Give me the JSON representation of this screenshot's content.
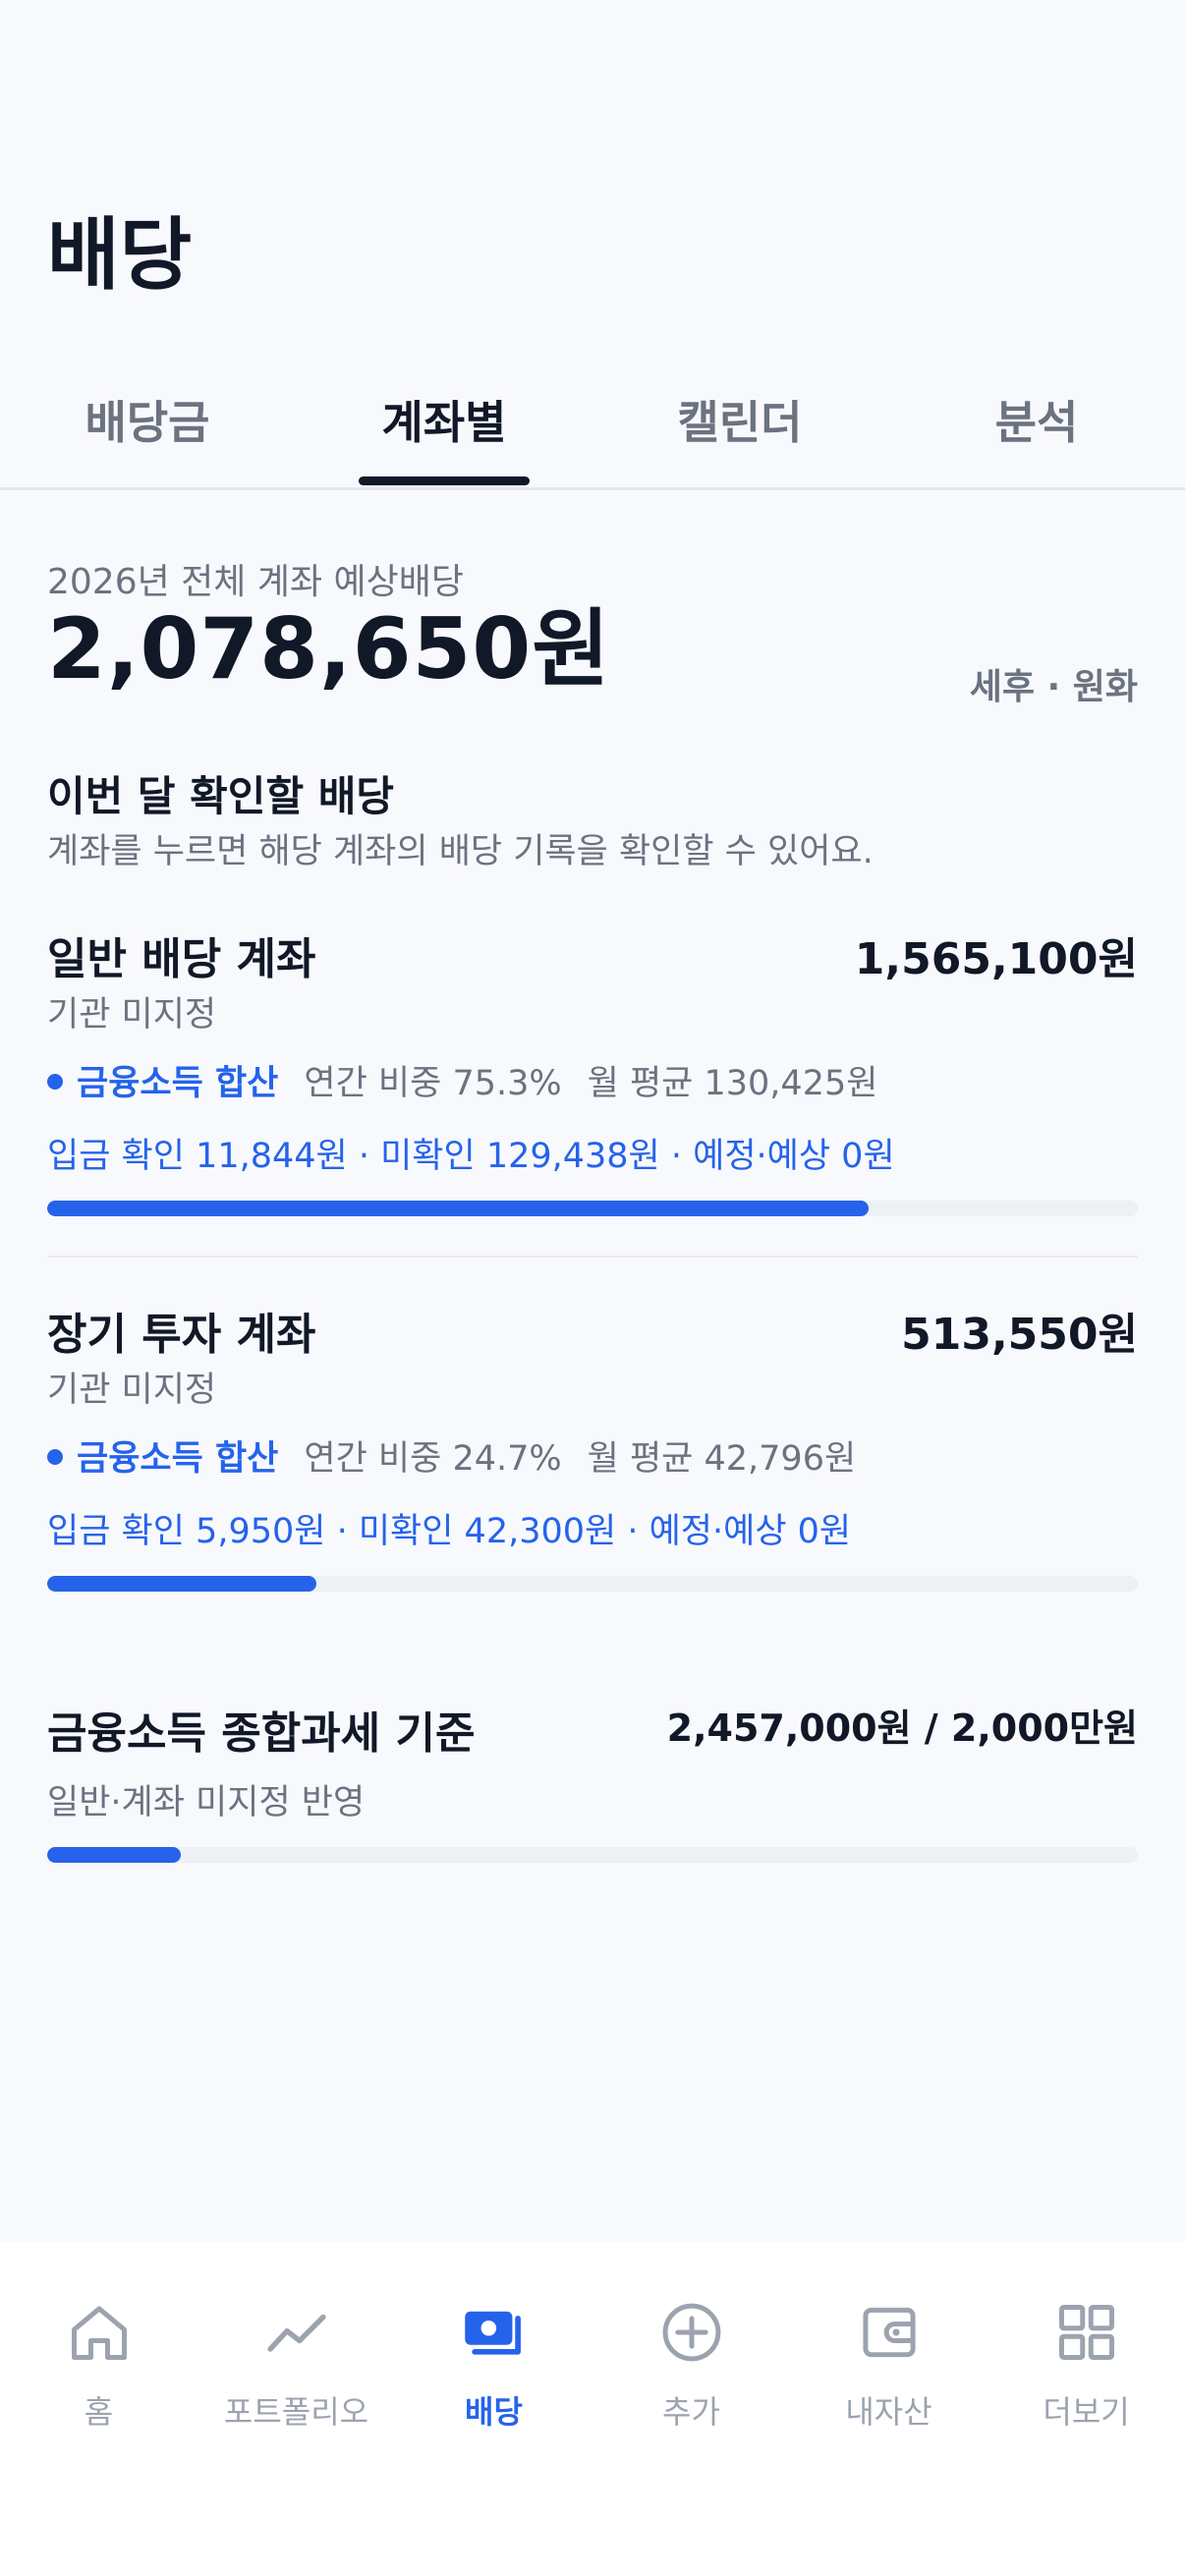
{
  "header": {
    "title": "배당"
  },
  "tabs": [
    {
      "label": "배당금"
    },
    {
      "label": "계좌별"
    },
    {
      "label": "캘린더"
    },
    {
      "label": "분석"
    }
  ],
  "summary": {
    "label": "2026년 전체 계좌 예상배당",
    "total": "2,078,650원",
    "note": "세후 · 원화"
  },
  "section": {
    "title": "이번 달 확인할 배당",
    "subtitle": "계좌를 누르면 해당 계좌의 배당 기록을 확인할 수 있어요."
  },
  "accounts": [
    {
      "name": "일반 배당 계좌",
      "amount": "1,565,100원",
      "institution": "기관 미지정",
      "tag": "금융소득 합산",
      "share": "연간 비중 75.3%",
      "monthly": "월 평균 130,425원",
      "status": "입금 확인 11,844원 · 미확인 129,438원 · 예정·예상 0원",
      "progress": 0.753
    },
    {
      "name": "장기 투자 계좌",
      "amount": "513,550원",
      "institution": "기관 미지정",
      "tag": "금융소득 합산",
      "share": "연간 비중 24.7%",
      "monthly": "월 평균 42,796원",
      "status": "입금 확인 5,950원 · 미확인 42,300원 · 예정·예상 0원",
      "progress": 0.247
    }
  ],
  "tax": {
    "title": "금융소득 종합과세 기준",
    "value": "2,457,000원 / 2,000만원",
    "subtitle": "일반·계좌 미지정 반영",
    "progress": 0.1229
  },
  "nav": [
    {
      "label": "홈",
      "icon": "home-icon"
    },
    {
      "label": "포트폴리오",
      "icon": "chart-line-icon"
    },
    {
      "label": "배당",
      "icon": "dividend-icon",
      "active": true
    },
    {
      "label": "추가",
      "icon": "plus-circle-icon"
    },
    {
      "label": "내자산",
      "icon": "wallet-icon"
    },
    {
      "label": "더보기",
      "icon": "grid-icon"
    }
  ],
  "colors": {
    "accent": "#2563EB",
    "background": "#F8F9FC",
    "text_primary": "#111827",
    "text_secondary": "#6B7280",
    "nav_inactive": "#9CA3AF"
  }
}
